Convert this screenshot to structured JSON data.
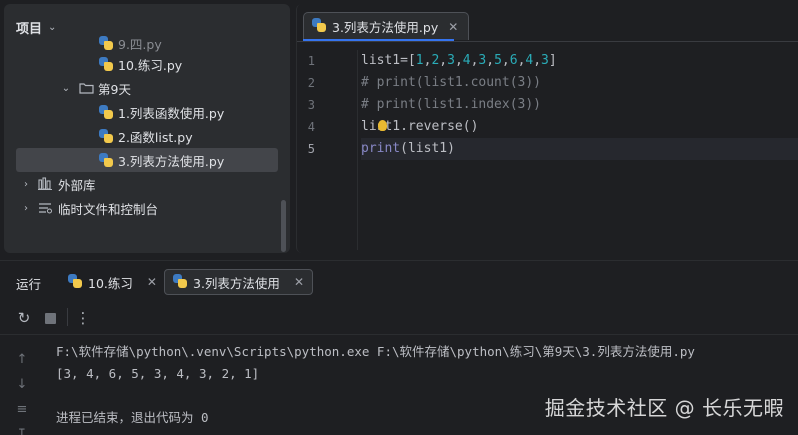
{
  "project": {
    "title": "项目",
    "tree": [
      {
        "label": "9.四.py",
        "type": "py",
        "depth": 3
      },
      {
        "label": "10.练习.py",
        "type": "py",
        "depth": 3
      },
      {
        "label": "第9天",
        "type": "folder",
        "depth": 2,
        "expanded": true
      },
      {
        "label": "1.列表函数使用.py",
        "type": "py",
        "depth": 3
      },
      {
        "label": "2.函数list.py",
        "type": "py",
        "depth": 3
      },
      {
        "label": "3.列表方法使用.py",
        "type": "py",
        "depth": 3,
        "selected": true
      },
      {
        "label": "外部库",
        "type": "library",
        "depth": 0
      },
      {
        "label": "临时文件和控制台",
        "type": "scratch",
        "depth": 0
      }
    ]
  },
  "editor": {
    "tab_label": "3.列表方法使用.py",
    "line_numbers": [
      "1",
      "2",
      "3",
      "4",
      "5"
    ],
    "current_line": 5,
    "code": [
      "list1=[1,2,3,4,3,5,6,4,3]",
      "# print(list1.count(3))",
      "# print(list1.index(3))",
      "list1.reverse()",
      "print(list1)"
    ]
  },
  "run": {
    "title": "运行",
    "tabs": [
      {
        "label": "10.练习",
        "active": false
      },
      {
        "label": "3.列表方法使用",
        "active": true
      }
    ],
    "console": [
      "F:\\软件存储\\python\\.venv\\Scripts\\python.exe F:\\软件存储\\python\\练习\\第9天\\3.列表方法使用.py",
      "[3, 4, 6, 5, 3, 4, 3, 2, 1]",
      "",
      "进程已结束，退出代码为 0"
    ]
  },
  "watermark": "掘金技术社区 @ 长乐无暇",
  "colors": {
    "background": "#1e1f22",
    "panel": "#2b2d30",
    "selection": "#43454a",
    "accent": "#3574f0",
    "number": "#2aacb8",
    "comment": "#7a7e85",
    "builtin": "#8888c6"
  }
}
